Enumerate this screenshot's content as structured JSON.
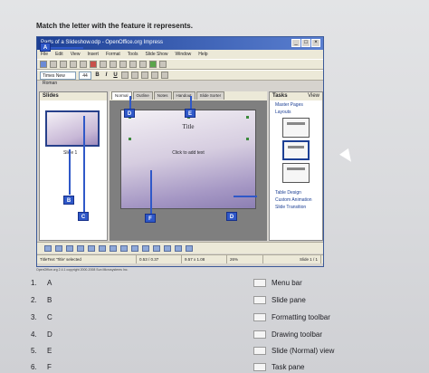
{
  "instruction": "Match the letter with the feature it represents.",
  "window": {
    "title": "Parts of a Slideshow.odp - OpenOffice.org Impress",
    "menu": [
      "File",
      "Edit",
      "View",
      "Insert",
      "Format",
      "Tools",
      "Slide Show",
      "Window",
      "Help"
    ],
    "font_name": "Times New Roman",
    "font_size": "44",
    "format_buttons": [
      "B",
      "I",
      "U"
    ]
  },
  "slides_pane": {
    "title": "Slides",
    "slide_label": "Slide 1"
  },
  "main_view": {
    "tabs": [
      "Normal",
      "Outline",
      "Notes",
      "Handout",
      "Slide Sorter"
    ],
    "active_tab": "Normal",
    "slide_title": "Title",
    "slide_body": "Click to add text"
  },
  "tasks_pane": {
    "title": "Tasks",
    "view_label": "View",
    "items_top": [
      "Master Pages",
      "Layouts"
    ],
    "items_bottom": [
      "Table Design",
      "Custom Animation",
      "Slide Transition"
    ]
  },
  "statusbar": {
    "selection": "TitleText 'Title' selected",
    "position": "0.53 / 0.37",
    "size": "9.57 x 1.08",
    "zoom": "26%",
    "slide": "Slide 1 / 1"
  },
  "copyright": "OpenOffice.org 2.4.1 copyright 2000-2008 Sun Microsystems Inc.",
  "markers": [
    "A",
    "B",
    "C",
    "D",
    "E",
    "F"
  ],
  "questions": [
    {
      "num": "1.",
      "letter": "A"
    },
    {
      "num": "2.",
      "letter": "B"
    },
    {
      "num": "3.",
      "letter": "C"
    },
    {
      "num": "4.",
      "letter": "D"
    },
    {
      "num": "5.",
      "letter": "E"
    },
    {
      "num": "6.",
      "letter": "F"
    }
  ],
  "answers": [
    "Menu bar",
    "Slide pane",
    "Formatting toolbar",
    "Drawing toolbar",
    "Slide (Normal) view",
    "Task pane"
  ],
  "colors": {
    "marker": "#2f58c8",
    "titlebar": "#1c3f94"
  }
}
